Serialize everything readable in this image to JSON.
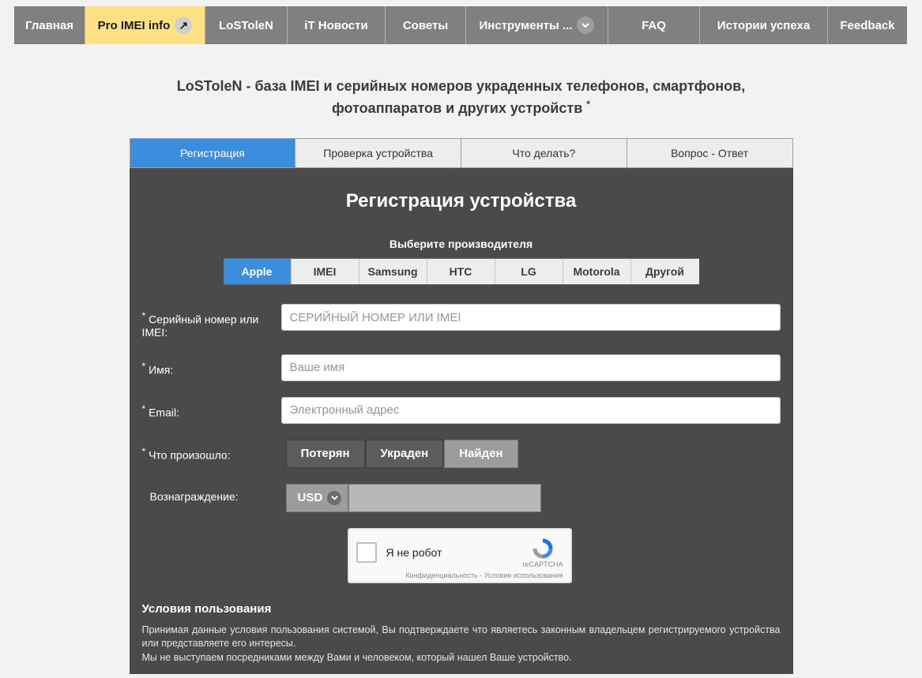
{
  "nav": [
    "Главная",
    "Pro IMEI info",
    "LoSToleN",
    "iT Новости",
    "Советы",
    "Инструменты ...",
    "FAQ",
    "Истории успеха",
    "Feedback"
  ],
  "heading": {
    "l1": "LoSToleN - база IMEI и серийных номеров украденных телефонов, смартфонов,",
    "l2": "фотоаппаратов и других устройств"
  },
  "subtabs": [
    "Регистрация",
    "Проверка устройства",
    "Что делать?",
    "Вопрос - Ответ"
  ],
  "panel_title": "Регистрация устройства",
  "mfr_label": "Выберите производителя",
  "mfrs": [
    "Apple",
    "IMEI",
    "Samsung",
    "HTC",
    "LG",
    "Motorola",
    "Другой"
  ],
  "labels": {
    "serial": "Серийный номер или IMEI:",
    "name": "Имя:",
    "email": "Email:",
    "what": "Что произошло:",
    "reward": "Вознаграждение:"
  },
  "placeholders": {
    "serial": "СЕРИЙНЫЙ НОМЕР ИЛИ IMEI",
    "name": "Ваше имя",
    "email": "Электронный адрес"
  },
  "status": [
    "Потерян",
    "Украден",
    "Найден"
  ],
  "currency": "USD",
  "recaptcha": {
    "label": "Я не робот",
    "brand": "reCAPTCHA",
    "footer": "Конфиденциальность - Условия использования"
  },
  "terms": {
    "h": "Условия пользования",
    "p1": "Принимая данные условия пользования системой, Вы подтверждаете что являетесь законным владельцем регистрируемого устройства или представляете его интересы.",
    "p2": "Мы не выступаем посредниками между Вами и человеком, который нашел Ваше устройство."
  }
}
